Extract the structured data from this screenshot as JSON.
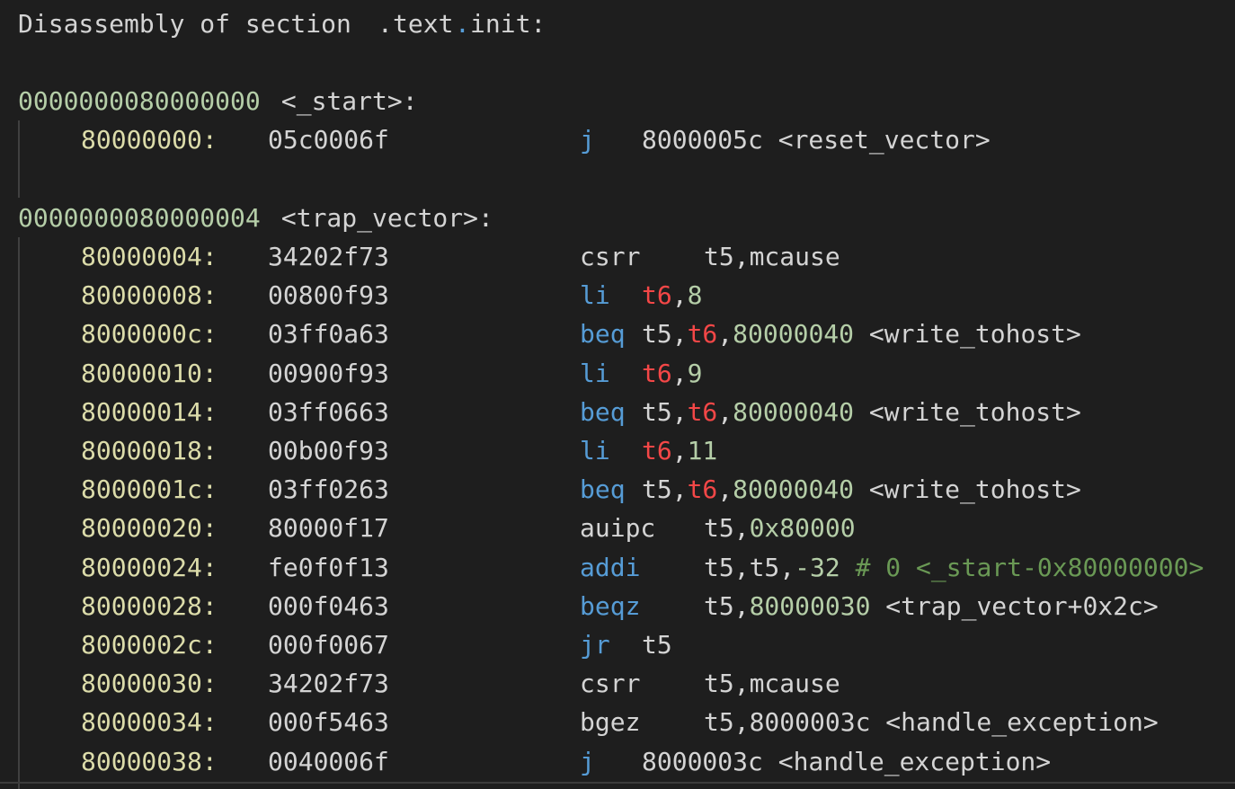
{
  "header": {
    "prefix": "Disassembly of section ",
    "sep": ".",
    "text": "text",
    "init": "init:"
  },
  "start_label": {
    "address": "0000000080000000",
    "symbol": " <_start>:"
  },
  "trap_label": {
    "address": "0000000080000004",
    "symbol": " <trap_vector>:"
  },
  "instructions": [
    {
      "addr": "80000000:",
      "hex": "05c0006f",
      "mnem": "j",
      "ops": [
        [
          "plain",
          "8000005c <reset_vector>"
        ]
      ]
    },
    {
      "addr": "80000004:",
      "hex": "34202f73",
      "mnem": "csrr",
      "ops": [
        [
          "plain",
          "t5,mcause"
        ]
      ]
    },
    {
      "addr": "80000008:",
      "hex": "00800f93",
      "mnem": "li",
      "ops": [
        [
          "reg",
          "t6"
        ],
        [
          "plain",
          ","
        ],
        [
          "num",
          "8"
        ]
      ]
    },
    {
      "addr": "8000000c:",
      "hex": "03ff0a63",
      "mnem": "beq",
      "ops": [
        [
          "plain",
          "t5,"
        ],
        [
          "reg",
          "t6"
        ],
        [
          "plain",
          ","
        ],
        [
          "num",
          "80000040"
        ],
        [
          "plain",
          " <write_tohost>"
        ]
      ]
    },
    {
      "addr": "80000010:",
      "hex": "00900f93",
      "mnem": "li",
      "ops": [
        [
          "reg",
          "t6"
        ],
        [
          "plain",
          ","
        ],
        [
          "num",
          "9"
        ]
      ]
    },
    {
      "addr": "80000014:",
      "hex": "03ff0663",
      "mnem": "beq",
      "ops": [
        [
          "plain",
          "t5,"
        ],
        [
          "reg",
          "t6"
        ],
        [
          "plain",
          ","
        ],
        [
          "num",
          "80000040"
        ],
        [
          "plain",
          " <write_tohost>"
        ]
      ]
    },
    {
      "addr": "80000018:",
      "hex": "00b00f93",
      "mnem": "li",
      "ops": [
        [
          "reg",
          "t6"
        ],
        [
          "plain",
          ","
        ],
        [
          "num",
          "11"
        ]
      ]
    },
    {
      "addr": "8000001c:",
      "hex": "03ff0263",
      "mnem": "beq",
      "ops": [
        [
          "plain",
          "t5,"
        ],
        [
          "reg",
          "t6"
        ],
        [
          "plain",
          ","
        ],
        [
          "num",
          "80000040"
        ],
        [
          "plain",
          " <write_tohost>"
        ]
      ]
    },
    {
      "addr": "80000020:",
      "hex": "80000f17",
      "mnem": "auipc",
      "ops": [
        [
          "plain",
          "t5,"
        ],
        [
          "num",
          "0x80000"
        ]
      ]
    },
    {
      "addr": "80000024:",
      "hex": "fe0f0f13",
      "mnem": "addi",
      "ops": [
        [
          "plain",
          "t5,t5,"
        ],
        [
          "num",
          "-32"
        ],
        [
          "cmt",
          " # 0 <_start-0x80000000>"
        ]
      ]
    },
    {
      "addr": "80000028:",
      "hex": "000f0463",
      "mnem": "beqz",
      "ops": [
        [
          "plain",
          "t5,"
        ],
        [
          "num",
          "80000030"
        ],
        [
          "plain",
          " <trap_vector+0x2c>"
        ]
      ]
    },
    {
      "addr": "8000002c:",
      "hex": "000f0067",
      "mnem": "jr",
      "ops": [
        [
          "plain",
          "t5"
        ]
      ]
    },
    {
      "addr": "80000030:",
      "hex": "34202f73",
      "mnem": "csrr",
      "ops": [
        [
          "plain",
          "t5,mcause"
        ]
      ]
    },
    {
      "addr": "80000034:",
      "hex": "000f5463",
      "mnem": "bgez",
      "ops": [
        [
          "plain",
          "t5,8000003c <handle_exception>"
        ]
      ]
    },
    {
      "addr": "80000038:",
      "hex": "0040006f",
      "mnem": "j",
      "ops": [
        [
          "plain",
          "8000003c <handle_exception>"
        ]
      ]
    }
  ],
  "colors": {
    "background": "#1e1e1e",
    "text": "#d4d4d4",
    "number": "#b5cea8",
    "address": "#dcdcaa",
    "keyword": "#569cd6",
    "register": "#f44747",
    "comment": "#6a9955"
  }
}
